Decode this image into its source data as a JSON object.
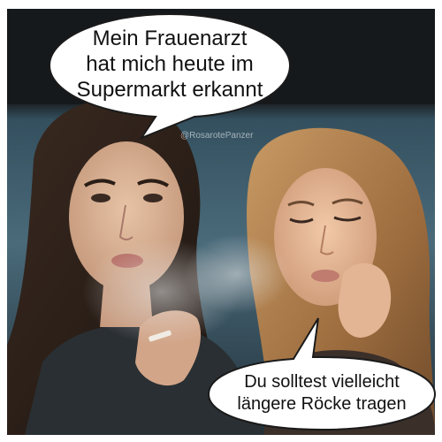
{
  "meme": {
    "top_speech": [
      "Mein Frauenarzt",
      "hat mich heute im",
      "Supermarkt erkannt"
    ],
    "bottom_speech": [
      "Du solltest vielleicht",
      "längere Röcke tragen"
    ],
    "watermark": "@RosarotePanzer"
  },
  "colors": {
    "background": "#ffffff",
    "bubble_fill": "#ffffff",
    "bubble_stroke": "#1a1a1a",
    "text": "#111111",
    "photo_backdrop": "#2c4452"
  }
}
